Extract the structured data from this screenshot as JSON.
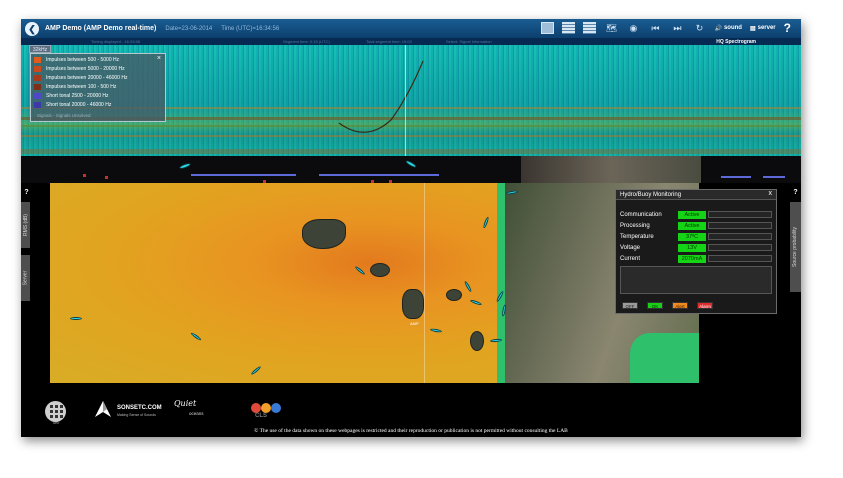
{
  "toolbar": {
    "title": "AMP Demo (AMP Demo real-time)",
    "date": "Date=23-06-2014",
    "time": "Time (UTC)=16:34:56",
    "sound_label": "sound",
    "server_label": "server",
    "help_label": "?"
  },
  "spectrogram": {
    "frequency_tab": "32kHz",
    "header_left": "Timing displayed - 16:33:58",
    "header_mid1": "Segment time: 0:15 (UTC)",
    "header_mid2": "Total segment time: 15:00",
    "header_right": "Select: Signal Information",
    "hq_label": "HQ Spectrogram"
  },
  "legend": {
    "close": "×",
    "items": [
      {
        "label": "Impulses between 500 - 5000 Hz",
        "color": "#e45a1b"
      },
      {
        "label": "Impulses between 5000 - 20000 Hz",
        "color": "#c9491c"
      },
      {
        "label": "Impulses between 20000 - 46000 Hz",
        "color": "#a73a1c"
      },
      {
        "label": "Impulses between 100 - 500 Hz",
        "color": "#7c301a"
      },
      {
        "label": "Short tonal 2500 - 20000 Hz",
        "color": "#4f49c9"
      },
      {
        "label": "Short tonal 20000 - 46000 Hz",
        "color": "#3d3aa8"
      }
    ],
    "footer": "Signals - Signals Unsolved"
  },
  "side_tabs": {
    "rms": "RMS (dB)",
    "server": "Server",
    "source": "Source probability",
    "help": "?"
  },
  "map": {
    "center_label": "AMP"
  },
  "hydro": {
    "title": "Hydro/Buoy Monitoring",
    "close": "x",
    "rows": [
      {
        "label": "Communication",
        "value": "Active"
      },
      {
        "label": "Processing",
        "value": "Active"
      },
      {
        "label": "Temperature",
        "value": "37ºC"
      },
      {
        "label": "Voltage",
        "value": "13V"
      },
      {
        "label": "Current",
        "value": "2070mA"
      }
    ],
    "buttons": [
      {
        "label": "OFF",
        "color": "#9a9a9a"
      },
      {
        "label": "OK",
        "color": "#19d019"
      },
      {
        "label": "Alert",
        "color": "#f08a1e"
      },
      {
        "label": "Alarm",
        "color": "#e12a2a"
      }
    ]
  },
  "footer": {
    "upc": "UPC",
    "sonsetc_name": "SONSETC.COM",
    "sonsetc_tag": "Making Sense of Sounds",
    "quiet_name": "Quiet",
    "quiet_sub": "oceans",
    "cls": "CLS",
    "disclaimer": "© The use of the data shown on these webpages is restricted and their reproduction or publication is not permitted without consulting the LAB"
  }
}
